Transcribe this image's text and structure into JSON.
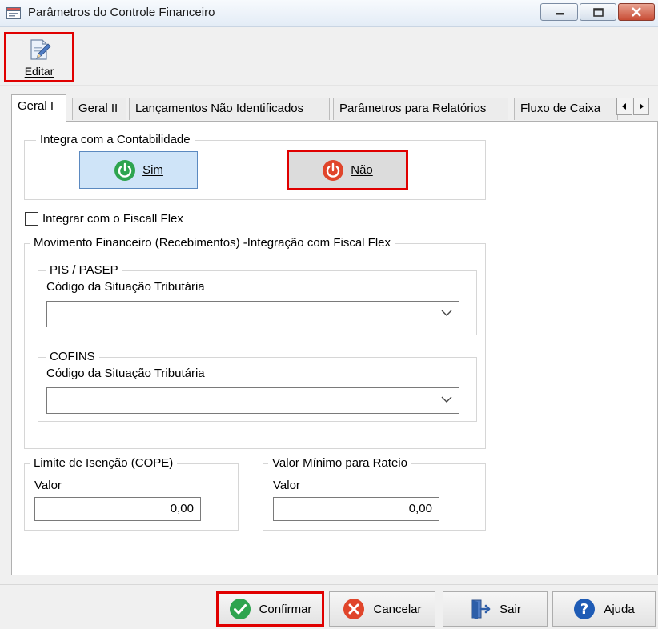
{
  "window": {
    "title": "Parâmetros do Controle Financeiro",
    "icon": "app-form-icon"
  },
  "toolbar": {
    "edit_label": "Editar",
    "edit_icon": "edit-pencil-icon"
  },
  "tabs": [
    {
      "label": "Geral I",
      "active": true
    },
    {
      "label": "Geral II",
      "active": false
    },
    {
      "label": "Lançamentos Não Identificados",
      "active": false
    },
    {
      "label": "Parâmetros para Relatórios",
      "active": false
    },
    {
      "label": "Fluxo de Caixa",
      "active": false
    }
  ],
  "contabilidade": {
    "title": "Integra com a Contabilidade",
    "sim_label": "Sim",
    "nao_label": "Não",
    "selected": "Sim"
  },
  "fiscal_flex": {
    "label": "Integrar com o Fiscall Flex",
    "checked": false
  },
  "movimento": {
    "title": "Movimento Financeiro (Recebimentos) -Integração com Fiscal Flex",
    "pis": {
      "title": "PIS / PASEP",
      "field_label": "Código da Situação Tributária",
      "value": ""
    },
    "cofins": {
      "title": "COFINS",
      "field_label": "Código da Situação Tributária",
      "value": ""
    }
  },
  "limite": {
    "title": "Limite de Isenção (COPE)",
    "field_label": "Valor",
    "value": "0,00"
  },
  "valor_minimo": {
    "title": "Valor Mínimo para Rateio",
    "field_label": "Valor",
    "value": "0,00"
  },
  "footer": {
    "confirm_label": "Confirmar",
    "cancel_label": "Cancelar",
    "exit_label": "Sair",
    "help_label": "Ajuda"
  },
  "colors": {
    "highlight_border": "#e00000",
    "sim_green": "#2ea44f",
    "nao_red": "#e0452b",
    "help_blue": "#1e5bb5"
  }
}
